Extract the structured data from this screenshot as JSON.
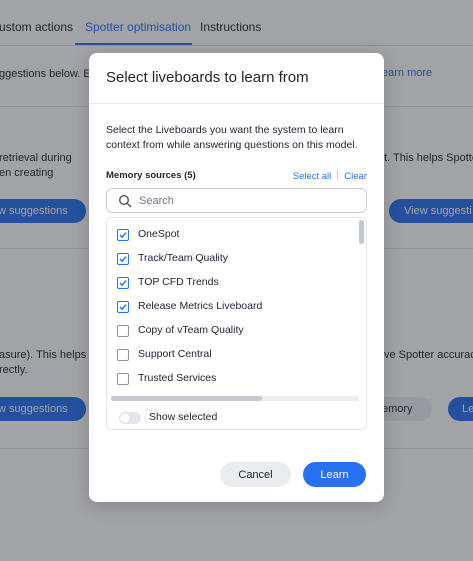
{
  "background": {
    "tabs": [
      {
        "label": "ustom actions"
      },
      {
        "label": "Spotter optimisation"
      },
      {
        "label": "Instructions"
      }
    ],
    "texts": {
      "intro_left": "ggestions below. Eac",
      "learn_more": "earn more",
      "sec1_left_line1": "retrieval during",
      "sec1_left_line2": "en creating",
      "sec1_right": "t. This helps Spotte",
      "sec2_left_line1": "asure). This helps",
      "sec2_left_line2": "rectly.",
      "sec2_right": "ve Spotter accurac"
    },
    "buttons": {
      "view_suggestions_left_1": "w suggestions",
      "view_suggestions_right_1": "View suggesti",
      "view_suggestions_left_2": "w suggestions",
      "memory": "emory",
      "le": "Le"
    }
  },
  "modal": {
    "title": "Select liveboards to learn from",
    "description": "Select the Liveboards you want the system to learn context from while answering questions on this model.",
    "memory_sources_label": "Memory sources (5)",
    "select_all": "Select all",
    "clear": "Clear",
    "search": {
      "placeholder": "Search",
      "value": ""
    },
    "items": [
      {
        "label": "OneSpot",
        "checked": true
      },
      {
        "label": "Track/Team Quality",
        "checked": true
      },
      {
        "label": "TOP CFD Trends",
        "checked": true
      },
      {
        "label": "Release Metrics Liveboard",
        "checked": true
      },
      {
        "label": "Copy of vTeam Quality",
        "checked": false
      },
      {
        "label": "Support Central",
        "checked": false
      },
      {
        "label": "Trusted Services",
        "checked": false
      }
    ],
    "show_selected_label": "Show selected",
    "show_selected_on": false,
    "cancel_label": "Cancel",
    "learn_label": "Learn"
  },
  "colors": {
    "accent": "#2770ef",
    "overlay": "rgba(33,36,44,0.42)"
  }
}
